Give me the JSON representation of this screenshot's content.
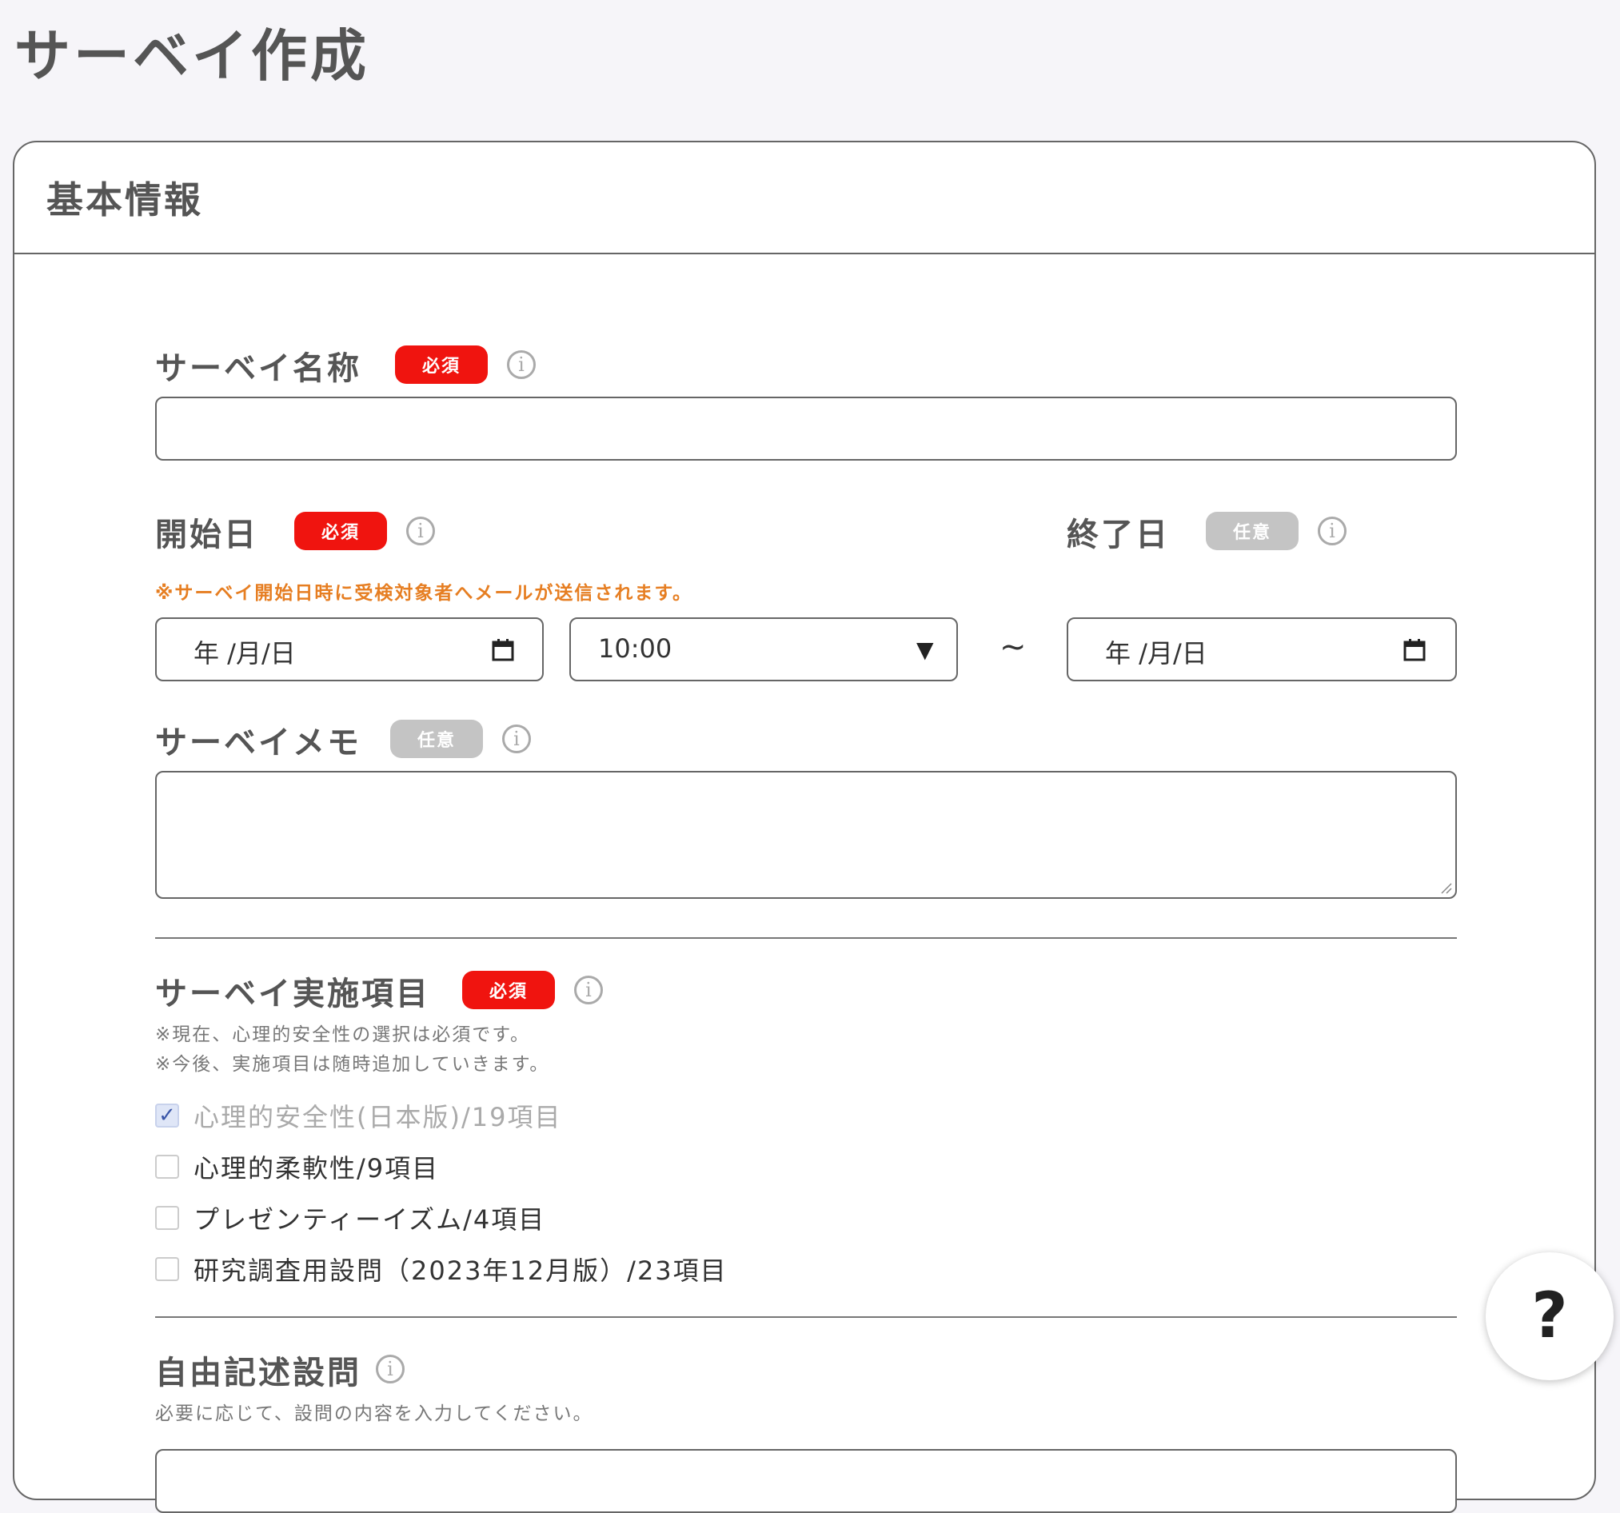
{
  "page": {
    "title": "サーベイ作成"
  },
  "card": {
    "title": "基本情報"
  },
  "survey_name": {
    "label": "サーベイ名称",
    "badge": "必須",
    "value": ""
  },
  "start_date": {
    "label": "開始日",
    "badge": "必須",
    "note": "※サーベイ開始日時に受検対象者へメールが送信されます。",
    "date_placeholder": "年 /月/日",
    "time_value": "10:00"
  },
  "end_date": {
    "label": "終了日",
    "badge": "任意",
    "date_placeholder": "年 /月/日"
  },
  "range_separator": "~",
  "survey_memo": {
    "label": "サーベイメモ",
    "badge": "任意",
    "value": ""
  },
  "survey_items": {
    "label": "サーベイ実施項目",
    "badge": "必須",
    "notes": [
      "※現在、心理的安全性の選択は必須です。",
      "※今後、実施項目は随時追加していきます。"
    ],
    "options": [
      {
        "label": "心理的安全性(日本版)/19項目",
        "checked": true,
        "disabled": true
      },
      {
        "label": "心理的柔軟性/9項目",
        "checked": false,
        "disabled": false
      },
      {
        "label": "プレゼンティーイズム/4項目",
        "checked": false,
        "disabled": false
      },
      {
        "label": "研究調査用設問（2023年12月版）/23項目",
        "checked": false,
        "disabled": false
      }
    ]
  },
  "free_text": {
    "label": "自由記述設問",
    "note": "必要に応じて、設問の内容を入力してください。"
  },
  "icons": {
    "info": "i",
    "help": "?",
    "checkmark": "✓",
    "dropdown": "▼"
  },
  "colors": {
    "required": "#f0140f",
    "optional": "#c4c4c4",
    "note": "#e67e22"
  }
}
